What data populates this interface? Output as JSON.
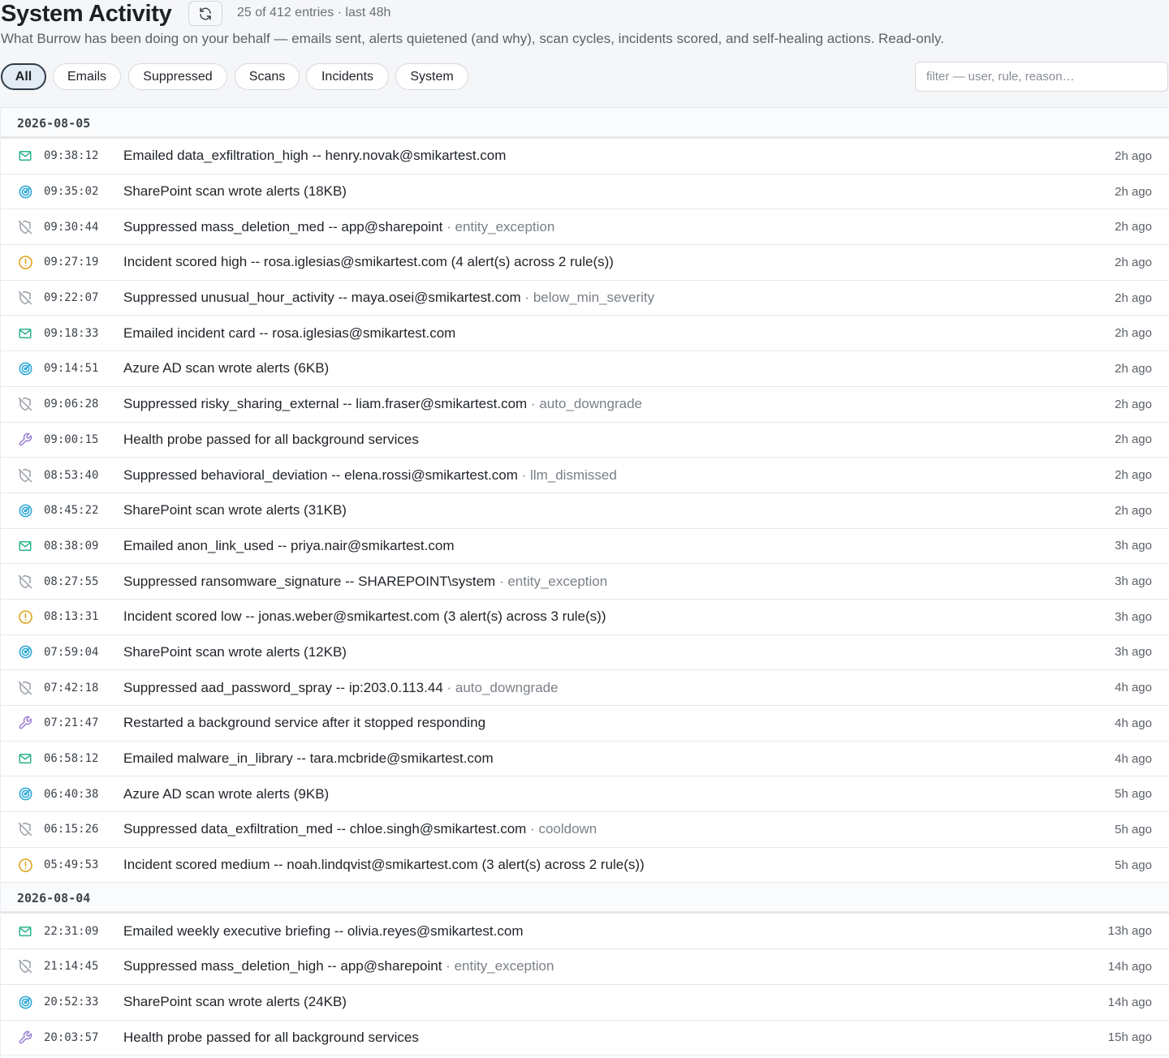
{
  "header": {
    "title": "System Activity",
    "refresh_icon": "refresh-icon",
    "count_text": "25 of 412 entries · last 48h",
    "subtitle": "What Burrow has been doing on your behalf — emails sent, alerts quietened (and why), scan cycles, incidents scored, and self-healing actions. Read-only."
  },
  "filters": {
    "chips": [
      {
        "label": "All",
        "active": true
      },
      {
        "label": "Emails",
        "active": false
      },
      {
        "label": "Suppressed",
        "active": false
      },
      {
        "label": "Scans",
        "active": false
      },
      {
        "label": "Incidents",
        "active": false
      },
      {
        "label": "System",
        "active": false
      }
    ],
    "search_placeholder": "filter — user, rule, reason…",
    "search_value": ""
  },
  "colors": {
    "email": "#2bb38c",
    "scan": "#2aa7d6",
    "suppressed": "#9aa0a8",
    "incident": "#e0a31a",
    "system": "#9a7fd6"
  },
  "groups": [
    {
      "date": "2026-08-05",
      "entries": [
        {
          "type": "email",
          "icon": "mail-icon",
          "time": "09:38:12",
          "text": "Emailed data_exfiltration_high -- henry.novak@smikartest.com",
          "ago": "2h ago"
        },
        {
          "type": "scan",
          "icon": "radar-icon",
          "time": "09:35:02",
          "text": "SharePoint scan wrote alerts (18KB)",
          "ago": "2h ago"
        },
        {
          "type": "suppressed",
          "icon": "shield-off-icon",
          "time": "09:30:44",
          "text": "Suppressed mass_deletion_med -- app@sharepoint",
          "reason": "entity_exception",
          "ago": "2h ago"
        },
        {
          "type": "incident",
          "icon": "alert-circle-icon",
          "time": "09:27:19",
          "text": "Incident scored high -- rosa.iglesias@smikartest.com (4 alert(s) across 2 rule(s))",
          "ago": "2h ago"
        },
        {
          "type": "suppressed",
          "icon": "shield-off-icon",
          "time": "09:22:07",
          "text": "Suppressed unusual_hour_activity -- maya.osei@smikartest.com",
          "reason": "below_min_severity",
          "ago": "2h ago"
        },
        {
          "type": "email",
          "icon": "mail-icon",
          "time": "09:18:33",
          "text": "Emailed incident card -- rosa.iglesias@smikartest.com",
          "ago": "2h ago"
        },
        {
          "type": "scan",
          "icon": "radar-icon",
          "time": "09:14:51",
          "text": "Azure AD scan wrote alerts (6KB)",
          "ago": "2h ago"
        },
        {
          "type": "suppressed",
          "icon": "shield-off-icon",
          "time": "09:06:28",
          "text": "Suppressed risky_sharing_external -- liam.fraser@smikartest.com",
          "reason": "auto_downgrade",
          "ago": "2h ago"
        },
        {
          "type": "system",
          "icon": "wrench-icon",
          "time": "09:00:15",
          "text": "Health probe passed for all background services",
          "ago": "2h ago"
        },
        {
          "type": "suppressed",
          "icon": "shield-off-icon",
          "time": "08:53:40",
          "text": "Suppressed behavioral_deviation -- elena.rossi@smikartest.com",
          "reason": "llm_dismissed",
          "ago": "2h ago"
        },
        {
          "type": "scan",
          "icon": "radar-icon",
          "time": "08:45:22",
          "text": "SharePoint scan wrote alerts (31KB)",
          "ago": "2h ago"
        },
        {
          "type": "email",
          "icon": "mail-icon",
          "time": "08:38:09",
          "text": "Emailed anon_link_used -- priya.nair@smikartest.com",
          "ago": "3h ago"
        },
        {
          "type": "suppressed",
          "icon": "shield-off-icon",
          "time": "08:27:55",
          "text": "Suppressed ransomware_signature -- SHAREPOINT\\system",
          "reason": "entity_exception",
          "ago": "3h ago"
        },
        {
          "type": "incident",
          "icon": "alert-circle-icon",
          "time": "08:13:31",
          "text": "Incident scored low -- jonas.weber@smikartest.com (3 alert(s) across 3 rule(s))",
          "ago": "3h ago"
        },
        {
          "type": "scan",
          "icon": "radar-icon",
          "time": "07:59:04",
          "text": "SharePoint scan wrote alerts (12KB)",
          "ago": "3h ago"
        },
        {
          "type": "suppressed",
          "icon": "shield-off-icon",
          "time": "07:42:18",
          "text": "Suppressed aad_password_spray -- ip:203.0.113.44",
          "reason": "auto_downgrade",
          "ago": "4h ago"
        },
        {
          "type": "system",
          "icon": "wrench-icon",
          "time": "07:21:47",
          "text": "Restarted a background service after it stopped responding",
          "ago": "4h ago"
        },
        {
          "type": "email",
          "icon": "mail-icon",
          "time": "06:58:12",
          "text": "Emailed malware_in_library -- tara.mcbride@smikartest.com",
          "ago": "4h ago"
        },
        {
          "type": "scan",
          "icon": "radar-icon",
          "time": "06:40:38",
          "text": "Azure AD scan wrote alerts (9KB)",
          "ago": "5h ago"
        },
        {
          "type": "suppressed",
          "icon": "shield-off-icon",
          "time": "06:15:26",
          "text": "Suppressed data_exfiltration_med -- chloe.singh@smikartest.com",
          "reason": "cooldown",
          "ago": "5h ago"
        },
        {
          "type": "incident",
          "icon": "alert-circle-icon",
          "time": "05:49:53",
          "text": "Incident scored medium -- noah.lindqvist@smikartest.com (3 alert(s) across 2 rule(s))",
          "ago": "5h ago"
        }
      ]
    },
    {
      "date": "2026-08-04",
      "entries": [
        {
          "type": "email",
          "icon": "mail-icon",
          "time": "22:31:09",
          "text": "Emailed weekly executive briefing -- olivia.reyes@smikartest.com",
          "ago": "13h ago"
        },
        {
          "type": "suppressed",
          "icon": "shield-off-icon",
          "time": "21:14:45",
          "text": "Suppressed mass_deletion_high -- app@sharepoint",
          "reason": "entity_exception",
          "ago": "14h ago"
        },
        {
          "type": "scan",
          "icon": "radar-icon",
          "time": "20:52:33",
          "text": "SharePoint scan wrote alerts (24KB)",
          "ago": "14h ago"
        },
        {
          "type": "system",
          "icon": "wrench-icon",
          "time": "20:03:57",
          "text": "Health probe passed for all background services",
          "ago": "15h ago"
        }
      ]
    }
  ]
}
